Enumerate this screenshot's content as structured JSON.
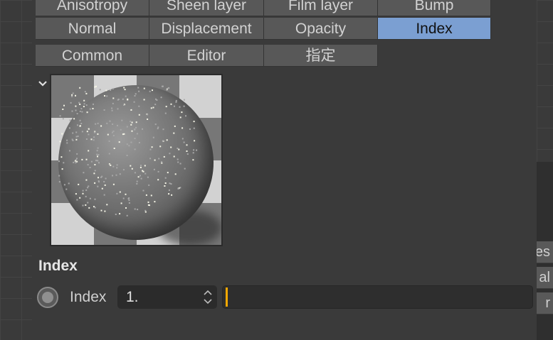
{
  "tabs_row0": [
    "Anisotropy",
    "Sheen layer",
    "Film layer",
    "Bump"
  ],
  "tabs_row1": [
    "Normal",
    "Displacement",
    "Opacity",
    "Index"
  ],
  "tabs_row2": [
    "Common",
    "Editor",
    "指定"
  ],
  "active_tab": "Index",
  "section": {
    "title": "Index"
  },
  "index_param": {
    "label": "Index",
    "value": "1.",
    "slider_level": 0.0
  },
  "side_cells": [
    "es",
    "al",
    "r"
  ],
  "colors": {
    "accent_tab": "#7b9fd2",
    "slider_handle": "#f5a800",
    "panel": "#3a3a3a"
  },
  "icons": {
    "collapse": "chevron-down-icon",
    "stepper": "stepper-arrows-icon",
    "radio": "radio-icon"
  }
}
